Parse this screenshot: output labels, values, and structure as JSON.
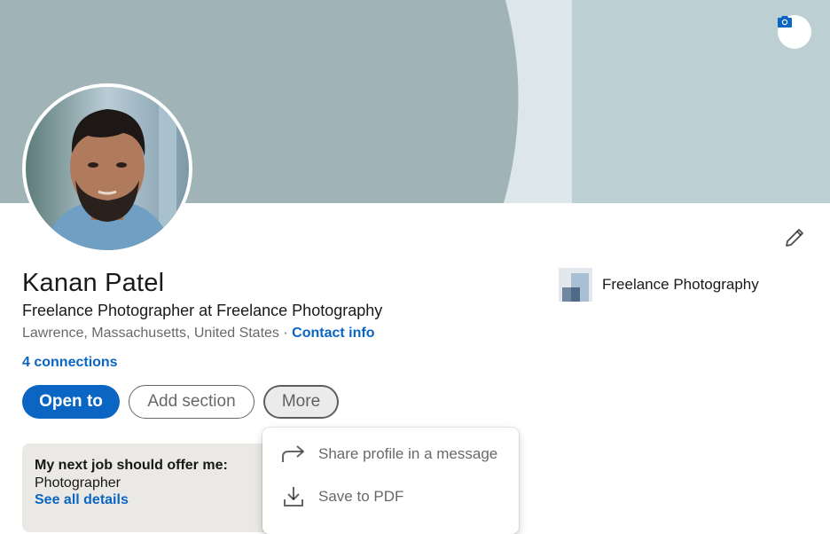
{
  "profile": {
    "name": "Kanan Patel",
    "headline": "Freelance Photographer at Freelance Photography",
    "location": "Lawrence, Massachusetts, United States",
    "separator": "·",
    "contact_info_label": "Contact info",
    "connections_label": "4 connections"
  },
  "actions": {
    "open_to_label": "Open to",
    "add_section_label": "Add section",
    "more_label": "More"
  },
  "experience_company": {
    "name": "Freelance Photography",
    "logo_icon": "company-logo"
  },
  "open_to_work_card": {
    "title": "My next job should offer me:",
    "value": "Photographer",
    "link_label": "See all details"
  },
  "more_menu": {
    "items": [
      {
        "label": "Share profile in a message",
        "icon": "share-arrow-icon"
      },
      {
        "label": "Save to PDF",
        "icon": "download-icon"
      }
    ]
  },
  "icons": {
    "banner_camera": "camera-icon",
    "edit_intro": "pencil-icon"
  },
  "colors": {
    "primary": "#0a66c2",
    "banner_left": "#a0b4b8",
    "banner_right": "#bccfd3",
    "card_background": "#ebe9e5"
  }
}
